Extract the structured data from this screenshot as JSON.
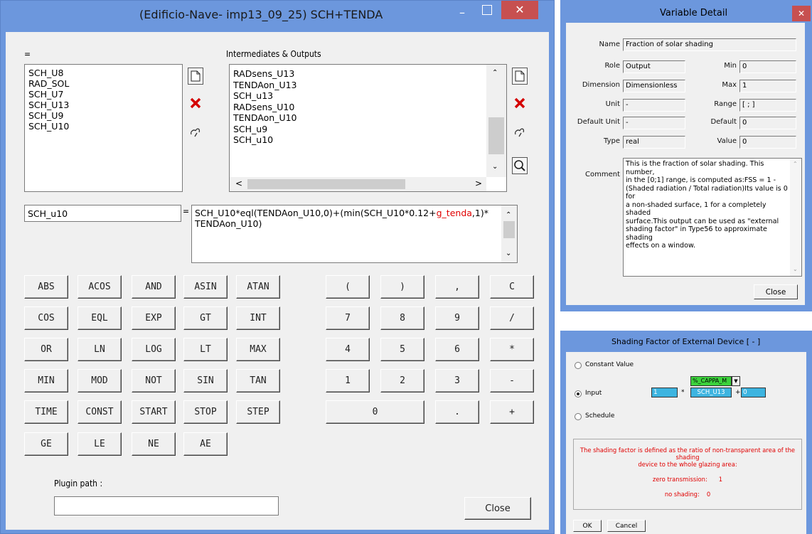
{
  "eq": {
    "title": "(Edificio-Nave- imp13_09_25) SCH+TENDA",
    "left_label": "=",
    "right_label": "Intermediates & Outputs",
    "inputs": [
      "SCH_U8",
      "RAD_SOL",
      "SCH_U7",
      "SCH_U13",
      "SCH_U9",
      "SCH_U10"
    ],
    "outputs": [
      "RADsens_U13",
      "TENDAon_U13",
      "SCH_u13",
      "RADsens_U10",
      "TENDAon_U10",
      "SCH_u9",
      "SCH_u10"
    ],
    "var_name": "SCH_u10",
    "eq_sign": "=",
    "expr_p1": "SCH_U10*eql(TENDAon_U10,0)+(min(SCH_U10*0.12+",
    "expr_red": "g_tenda",
    "expr_p2": ",1)*",
    "expr_line2": "TENDAon_U10)",
    "func_buttons": [
      [
        "ABS",
        "ACOS",
        "AND",
        "ASIN",
        "ATAN"
      ],
      [
        "COS",
        "EQL",
        "EXP",
        "GT",
        "INT"
      ],
      [
        "OR",
        "LN",
        "LOG",
        "LT",
        "MAX"
      ],
      [
        "MIN",
        "MOD",
        "NOT",
        "SIN",
        "TAN"
      ],
      [
        "TIME",
        "CONST",
        "START",
        "STOP",
        "STEP"
      ],
      [
        "GE",
        "LE",
        "NE",
        "AE"
      ]
    ],
    "keypad": [
      [
        "(",
        ")",
        ",",
        "C"
      ],
      [
        "7",
        "8",
        "9",
        "/"
      ],
      [
        "4",
        "5",
        "6",
        "*"
      ],
      [
        "1",
        "2",
        "3",
        "-"
      ],
      [
        "0",
        ".",
        "+"
      ]
    ],
    "plugin_label": "Plugin path :",
    "plugin_value": "",
    "close_label": "Close",
    "winbtn_min": "–",
    "winbtn_close": "✕"
  },
  "vd": {
    "title": "Variable Detail",
    "name_label": "Name",
    "name_value": "Fraction of solar shading",
    "role_label": "Role",
    "role_value": "Output",
    "dim_label": "Dimension",
    "dim_value": "Dimensionless",
    "unit_label": "Unit",
    "unit_value": "-",
    "dunit_label": "Default Unit",
    "dunit_value": "-",
    "type_label": "Type",
    "type_value": "real",
    "min_label": "Min",
    "min_value": "0",
    "max_label": "Max",
    "max_value": "1",
    "range_label": "Range",
    "range_value": "[ ; ]",
    "default_label": "Default",
    "default_value": "0",
    "value_label": "Value",
    "value_value": "0",
    "comment_label": "Comment",
    "comment_lines": [
      "This is the fraction of solar shading. This number,",
      "in the [0;1] range, is computed as:FSS = 1 -",
      "(Shaded radiation / Total radiation)Its value is 0 for",
      "a non-shaded surface, 1 for a completely shaded",
      "surface.This output can be used as \"external",
      "shading factor\" in Type56 to approximate shading",
      "effects on a window."
    ],
    "close_label": "Close",
    "close_x": "✕"
  },
  "sf": {
    "title": "Shading Factor of External Device  [ - ]",
    "opt_constant": "Constant Value",
    "opt_input": "Input",
    "opt_schedule": "Schedule",
    "input_mult": "1",
    "input_times": "*",
    "dropdown_value": "%_CAPPA_M",
    "var_value": "SCH_U13",
    "input_plus": "+",
    "input_add": "0",
    "note_line1": "The shading factor is defined as the ratio of non-transparent area of the shading",
    "note_line2": "device to the whole glazing area:",
    "zero_label": "zero transmission:",
    "zero_value": "1",
    "noshade_label": "no shading:",
    "noshade_value": "0",
    "ok_label": "OK",
    "cancel_label": "Cancel"
  },
  "colors": {
    "titlebar": "#6c97dd",
    "close_red": "#c75050",
    "note_red": "#e00000",
    "field_cyan": "#3db4e0",
    "dropdown_green": "#3cd23c"
  }
}
